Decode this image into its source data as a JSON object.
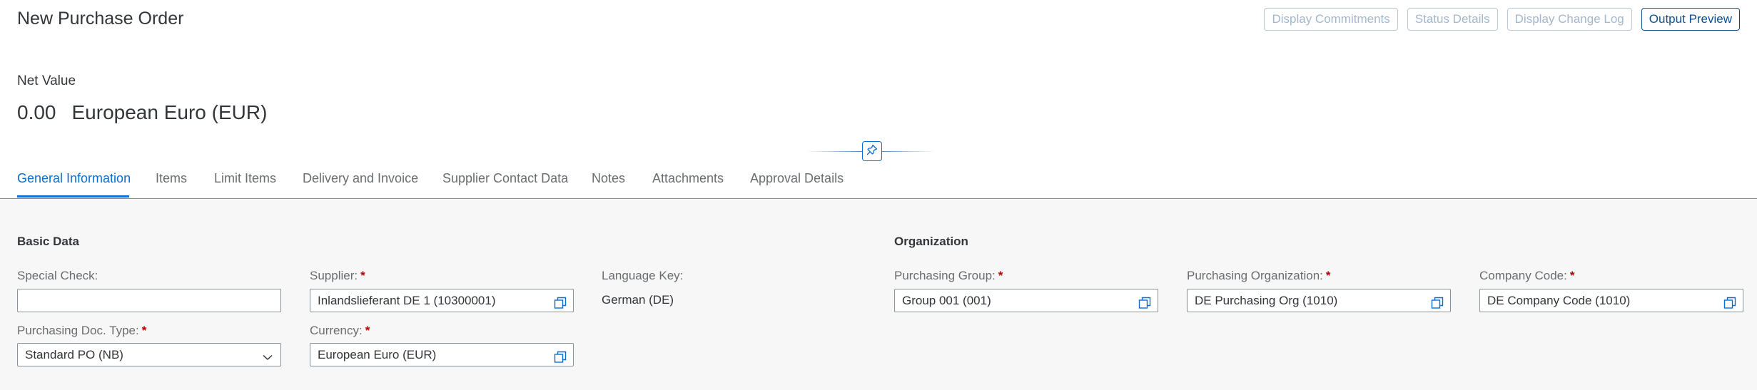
{
  "header": {
    "title": "New Purchase Order",
    "actions": [
      {
        "label": "Display Commitments",
        "enabled": false
      },
      {
        "label": "Status Details",
        "enabled": false
      },
      {
        "label": "Display Change Log",
        "enabled": false
      },
      {
        "label": "Output Preview",
        "enabled": true
      }
    ]
  },
  "kpi": {
    "label": "Net Value",
    "amount": "0.00",
    "currency": "European Euro (EUR)"
  },
  "tabs": [
    {
      "label": "General Information",
      "active": true
    },
    {
      "label": "Items"
    },
    {
      "label": "Limit Items"
    },
    {
      "label": "Delivery and Invoice"
    },
    {
      "label": "Supplier Contact Data"
    },
    {
      "label": "Notes"
    },
    {
      "label": "Attachments"
    },
    {
      "label": "Approval Details"
    }
  ],
  "basic_data": {
    "title": "Basic Data",
    "special_check": {
      "label": "Special Check:",
      "value": ""
    },
    "supplier": {
      "label": "Supplier:",
      "value": "Inlandslieferant DE 1 (10300001)",
      "required": true
    },
    "language_key": {
      "label": "Language Key:",
      "value": "German (DE)"
    },
    "doc_type": {
      "label": "Purchasing Doc. Type:",
      "value": "Standard PO (NB)",
      "required": true
    },
    "currency": {
      "label": "Currency:",
      "value": "European Euro (EUR)",
      "required": true
    }
  },
  "organization": {
    "title": "Organization",
    "purchasing_group": {
      "label": "Purchasing Group:",
      "value": "Group 001 (001)",
      "required": true
    },
    "purchasing_org": {
      "label": "Purchasing Organization:",
      "value": "DE Purchasing Org (1010)",
      "required": true
    },
    "company_code": {
      "label": "Company Code:",
      "value": "DE Company Code (1010)",
      "required": true
    }
  },
  "required_marker": "*",
  "icons": {
    "value_help": "value-help-icon",
    "dropdown": "chevron-down-icon",
    "pin": "pin-icon"
  },
  "colors": {
    "accent": "#0a6ed1",
    "required": "#bb0000",
    "content_bg": "#f7f7f7"
  }
}
